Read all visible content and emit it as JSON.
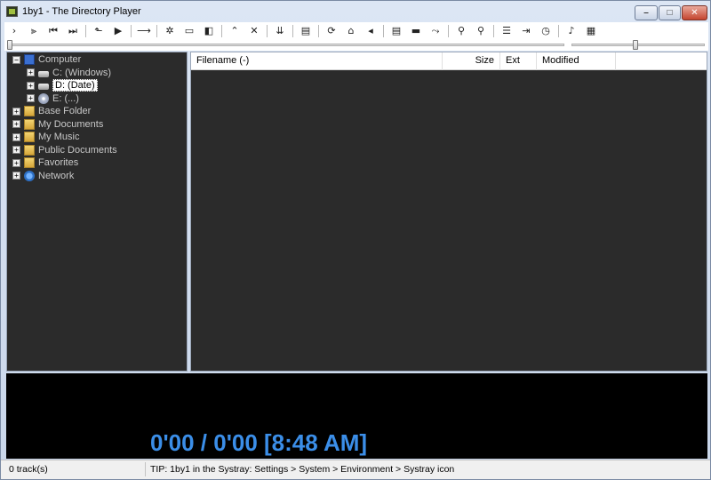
{
  "window": {
    "title": "1by1 - The Directory Player"
  },
  "title_buttons": {
    "minimize": "–",
    "maximize": "□",
    "close": "✕"
  },
  "toolbar": {
    "groups": [
      [
        "›",
        "⫸",
        "⏮",
        "⏭"
      ],
      [
        "⬑",
        "▶"
      ],
      [
        "⟶"
      ],
      [
        "✲",
        "▭",
        "◧"
      ],
      [
        "⌃",
        "✕"
      ],
      [
        "⇊"
      ],
      [
        "▤"
      ],
      [
        "⟳",
        "⌂",
        "◂"
      ],
      [
        "▤",
        "▬",
        "⤳"
      ],
      [
        "⚲",
        "⚲"
      ],
      [
        "☰",
        "⇥",
        "◷"
      ],
      [
        "♪",
        "▦"
      ]
    ]
  },
  "tree": {
    "items": [
      {
        "label": "Computer",
        "icon": "computer-icon",
        "expander": "−",
        "level": 0
      },
      {
        "label": "C: (Windows)",
        "icon": "drive-icon",
        "expander": "+",
        "level": 1
      },
      {
        "label": "D: (Date)",
        "icon": "drive-icon",
        "expander": "+",
        "level": 1,
        "selected": true
      },
      {
        "label": "E: (...)",
        "icon": "cd-drive-icon",
        "expander": "+",
        "level": 1
      },
      {
        "label": "Base Folder",
        "icon": "folder-icon",
        "expander": "+",
        "level": 0
      },
      {
        "label": "My Documents",
        "icon": "folder-icon",
        "expander": "+",
        "level": 0
      },
      {
        "label": "My Music",
        "icon": "folder-icon",
        "expander": "+",
        "level": 0
      },
      {
        "label": "Public Documents",
        "icon": "folder-icon",
        "expander": "+",
        "level": 0
      },
      {
        "label": "Favorites",
        "icon": "folder-icon",
        "expander": "+",
        "level": 0
      },
      {
        "label": "Network",
        "icon": "network-icon",
        "expander": "+",
        "level": 0
      }
    ]
  },
  "file_list": {
    "columns": [
      "Filename (-)",
      "Size",
      "Ext",
      "Modified"
    ]
  },
  "player": {
    "time_display": "0'00 / 0'00    [8:48 AM]"
  },
  "status": {
    "tracks": "0 track(s)",
    "tip": "TIP: 1by1 in the Systray: Settings > System > Environment > Systray icon"
  },
  "colors": {
    "time": "#3b8ee8",
    "panel_bg": "#2b2b2b",
    "player_bg": "#000000"
  }
}
